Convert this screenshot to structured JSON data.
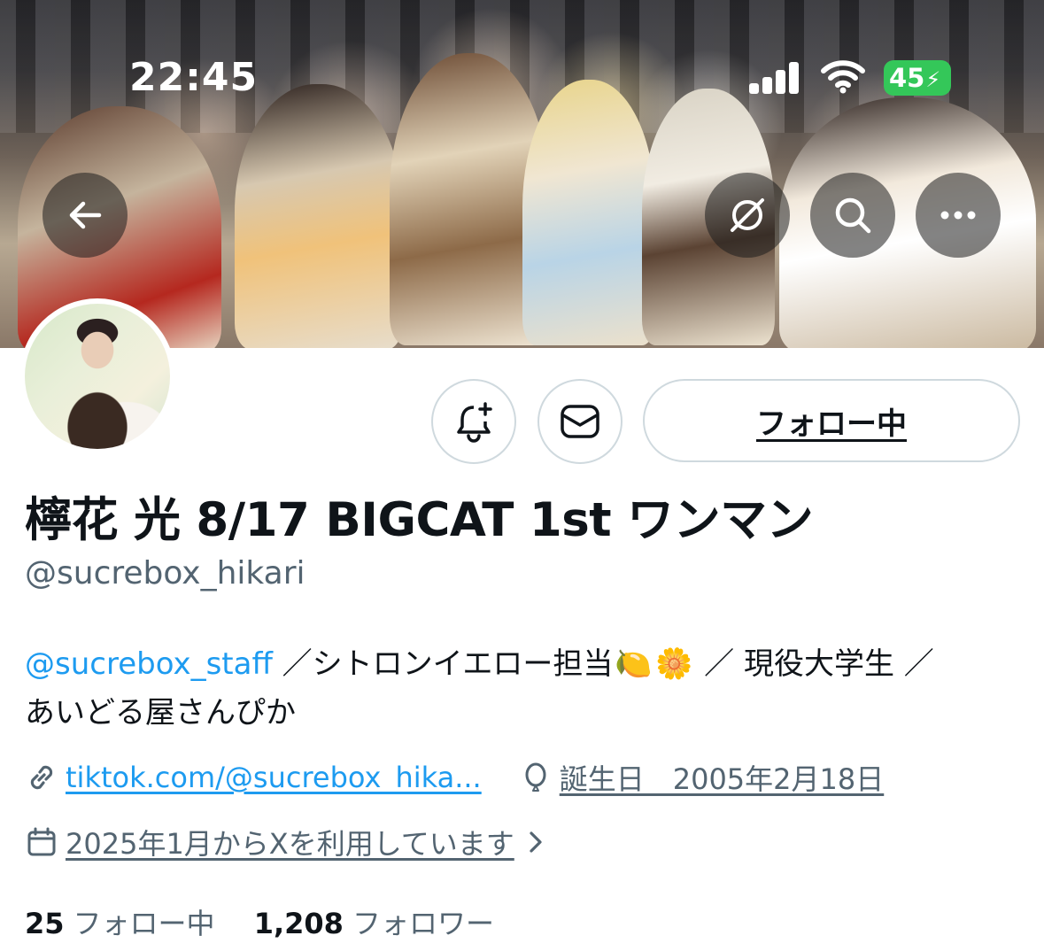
{
  "status_bar": {
    "time": "22:45",
    "battery": "45"
  },
  "header_buttons": {
    "back_icon": "arrow-left-icon",
    "grok_icon": "slash-circle-icon",
    "search_icon": "search-icon",
    "more_icon": "more-horizontal-icon"
  },
  "profile": {
    "follow_button_label": "フォロー中",
    "display_name": "檸花 光 8/17 BIGCAT 1st ワンマン",
    "handle": "@sucrebox_hikari",
    "bio": {
      "mention": "@sucrebox_staff",
      "text_part1": " ／シトロンイエロー担当",
      "emoji_lemon": "🍋",
      "emoji_flower": "🌼",
      "text_part2": " ／ 現役大学生 ／",
      "line2": "あいどる屋さんぴか"
    },
    "website": "tiktok.com/@sucrebox_hika...",
    "birthday": "誕生日　2005年2月18日",
    "joined": "2025年1月からXを利用しています",
    "following_count": "25",
    "following_label": "フォロー中",
    "followers_count": "1,208",
    "followers_label": "フォロワー"
  },
  "colors": {
    "accent": "#1d9bf0",
    "muted": "#536471",
    "border": "#cfd9de",
    "battery": "#34c759"
  }
}
